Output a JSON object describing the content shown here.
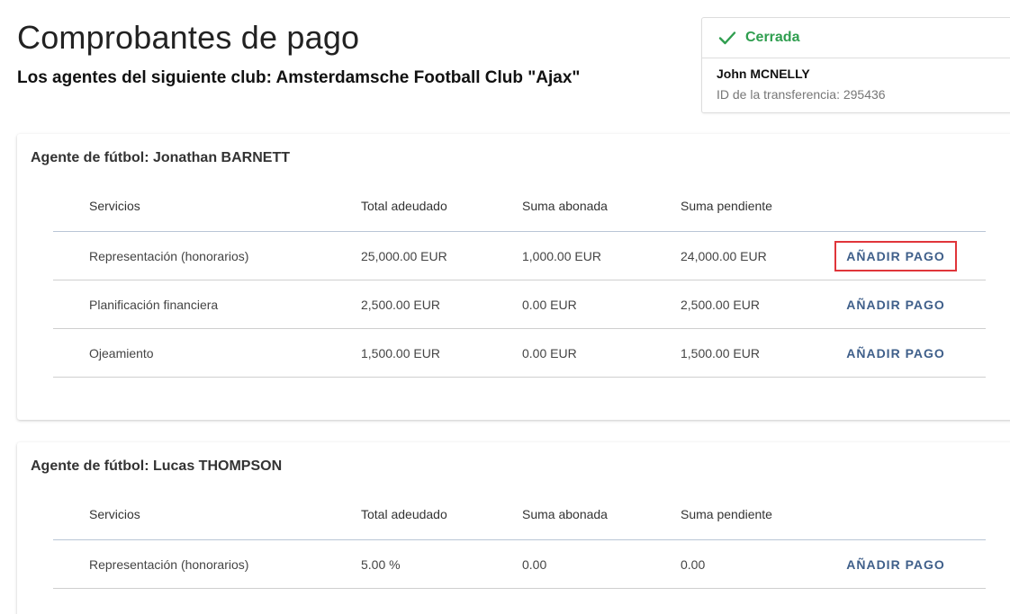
{
  "page": {
    "title": "Comprobantes de pago",
    "subtitle": "Los agentes del siguiente club: Amsterdamsche Football Club \"Ajax\""
  },
  "status_card": {
    "status": "Cerrada",
    "status_color": "#2f9e4f",
    "icon": "check-icon",
    "name": "John MCNELLY",
    "transfer_id": "ID de la transferencia: 295436"
  },
  "table_headers": {
    "services": "Servicios",
    "total": "Total adeudado",
    "paid": "Suma abonada",
    "pending": "Suma pendiente"
  },
  "agents": [
    {
      "title": "Agente de fútbol: Jonathan BARNETT",
      "rows": [
        {
          "service": "Representación (honorarios)",
          "total": "25,000.00 EUR",
          "paid": "1,000.00 EUR",
          "pending": "24,000.00 EUR",
          "action": "AÑADIR PAGO",
          "highlighted": true
        },
        {
          "service": "Planificación financiera",
          "total": "2,500.00 EUR",
          "paid": "0.00 EUR",
          "pending": "2,500.00 EUR",
          "action": "AÑADIR PAGO",
          "highlighted": false
        },
        {
          "service": "Ojeamiento",
          "total": "1,500.00 EUR",
          "paid": "0.00 EUR",
          "pending": "1,500.00 EUR",
          "action": "AÑADIR PAGO",
          "highlighted": false
        }
      ]
    },
    {
      "title": "Agente de fútbol: Lucas THOMPSON",
      "rows": [
        {
          "service": "Representación (honorarios)",
          "total": "5.00 %",
          "paid": "0.00",
          "pending": "0.00",
          "action": "AÑADIR PAGO",
          "highlighted": false
        }
      ]
    }
  ],
  "colors": {
    "accent_button": "#3f5f8a",
    "highlight_border": "#e0353a",
    "status_green": "#2f9e4f"
  }
}
